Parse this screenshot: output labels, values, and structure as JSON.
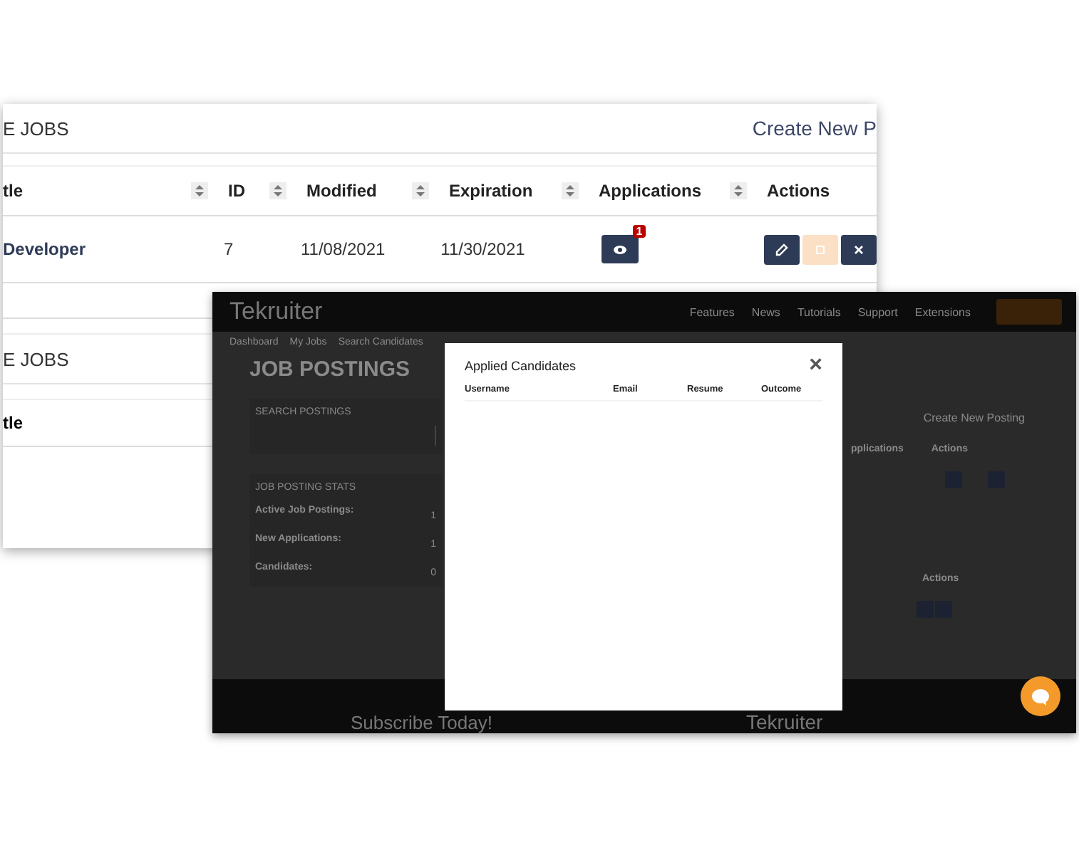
{
  "back_window": {
    "section_title": "E JOBS",
    "create_link": "Create New P",
    "columns": [
      {
        "label": "tle",
        "sortable": true
      },
      {
        "label": "ID",
        "sortable": true
      },
      {
        "label": "Modified",
        "sortable": true
      },
      {
        "label": "Expiration",
        "sortable": true
      },
      {
        "label": "Applications",
        "sortable": true
      },
      {
        "label": "Actions",
        "sortable": false
      }
    ],
    "rows": [
      {
        "title": "Developer",
        "id": "7",
        "modified": "11/08/2021",
        "expiration": "11/30/2021",
        "applications_badge": "1"
      }
    ],
    "second_section_title": "E JOBS",
    "second_column": "tle"
  },
  "front_window": {
    "logo": "Tekruiter",
    "nav": [
      "Features",
      "News",
      "Tutorials",
      "Support",
      "Extensions"
    ],
    "subnav": [
      "Dashboard",
      "My Jobs",
      "Search Candidates"
    ],
    "heading": "JOB POSTINGS",
    "search_label": "SEARCH POSTINGS",
    "create_link": "Create New Posting",
    "stats_title": "JOB POSTING STATS",
    "stats": [
      {
        "label": "Active Job Postings:",
        "value": "1"
      },
      {
        "label": "New Applications:",
        "value": "1"
      },
      {
        "label": "Candidates:",
        "value": "0"
      }
    ],
    "table_headers": [
      "pplications",
      "Actions"
    ],
    "second_table_header": "Actions",
    "footer_left": "Subscribe Today!",
    "footer_logo": "Tekruiter"
  },
  "modal": {
    "title": "Applied Candidates",
    "close": "×",
    "columns": [
      "Username",
      "Email",
      "Resume",
      "Outcome"
    ]
  }
}
